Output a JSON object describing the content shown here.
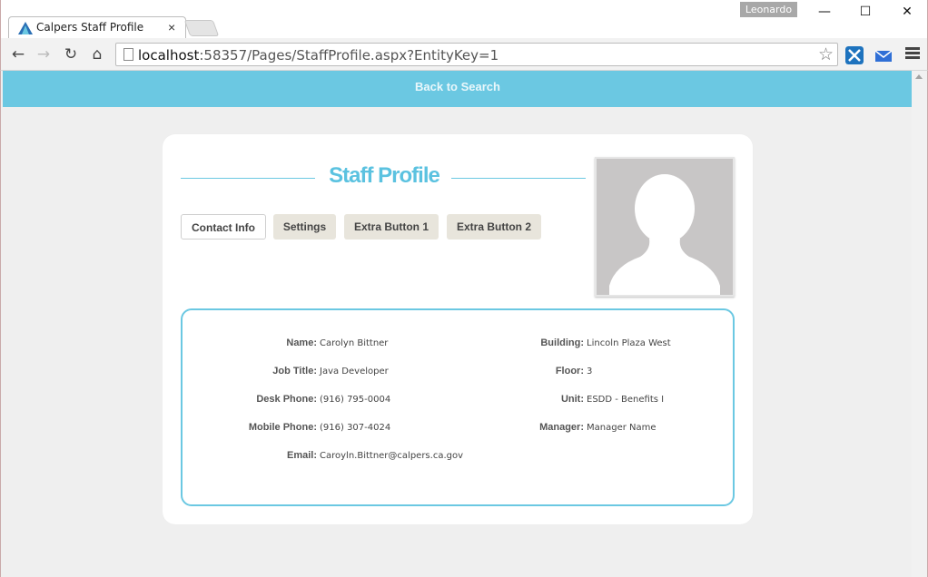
{
  "browser": {
    "tab_title": "Calpers Staff Profile",
    "tab_close": "×",
    "user": "Leonardo",
    "minimize": "—",
    "maximize": "☐",
    "close": "✕",
    "back": "←",
    "forward": "→",
    "reload": "↻",
    "home": "⌂",
    "url_host": "localhost",
    "url_rest": ":58357/Pages/StaffProfile.aspx?EntityKey=1",
    "star": "☆"
  },
  "page": {
    "back_to_search": "Back to Search",
    "title": "Staff Profile",
    "tabs": [
      {
        "label": "Contact Info",
        "active": true
      },
      {
        "label": "Settings",
        "active": false
      },
      {
        "label": "Extra Button 1",
        "active": false
      },
      {
        "label": "Extra Button 2",
        "active": false
      }
    ],
    "left_fields": [
      {
        "label": "Name:",
        "value": "Carolyn Bittner"
      },
      {
        "label": "Job Title:",
        "value": "Java Developer"
      },
      {
        "label": "Desk Phone:",
        "value": "(916) 795-0004"
      },
      {
        "label": "Mobile Phone:",
        "value": "(916) 307-4024"
      },
      {
        "label": "Email:",
        "value": "Caroyln.Bittner@calpers.ca.gov"
      }
    ],
    "right_fields": [
      {
        "label": "Building:",
        "value": "Lincoln Plaza West"
      },
      {
        "label": "Floor:",
        "value": "3"
      },
      {
        "label": "Unit:",
        "value": "ESDD - Benefits I"
      },
      {
        "label": "Manager:",
        "value": "Manager Name"
      }
    ]
  },
  "colors": {
    "accent": "#6bc8e2",
    "title": "#5bc2e0",
    "inactive_tab": "#e8e5dc",
    "avatar": "#c8c6c6"
  },
  "icons": [
    "tab-favicon-icon",
    "page-icon",
    "star-icon",
    "extension-icon",
    "mail-icon",
    "menu-icon",
    "avatar-silhouette-icon"
  ]
}
